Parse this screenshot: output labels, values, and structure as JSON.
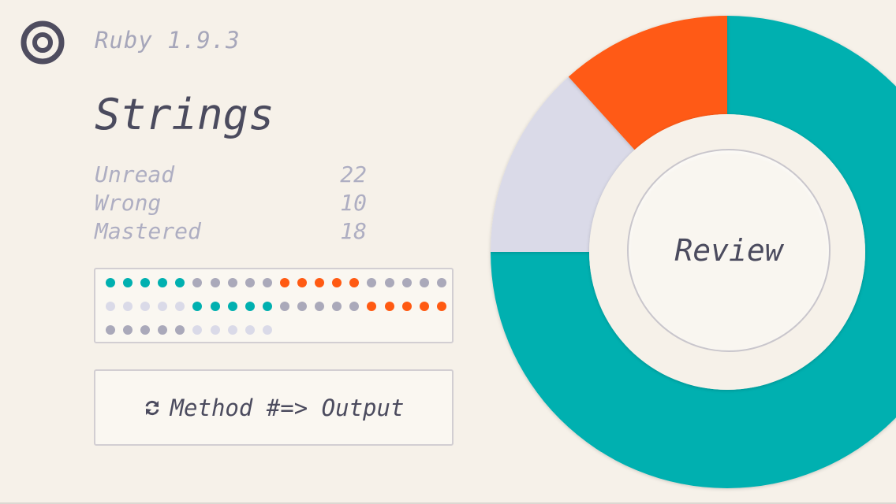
{
  "header": {
    "logo_icon": "target-rings-icon",
    "version": "Ruby 1.9.3"
  },
  "title": "Strings",
  "stats": [
    {
      "label": "Unread",
      "value": "22"
    },
    {
      "label": "Wrong",
      "value": "10"
    },
    {
      "label": "Mastered",
      "value": "18"
    }
  ],
  "colors": {
    "background": "#f6f1e9",
    "mastered": "#00b0b0",
    "wrong": "#ff5a12",
    "unread": "#dadae8",
    "seen": "#aaa9ba",
    "text_dark": "#4b4b5e",
    "text_muted": "#aeaec2"
  },
  "progress_dots": [
    "mastered",
    "mastered",
    "mastered",
    "mastered",
    "mastered",
    "seen",
    "seen",
    "seen",
    "seen",
    "seen",
    "wrong",
    "wrong",
    "wrong",
    "wrong",
    "wrong",
    "seen",
    "seen",
    "seen",
    "seen",
    "seen",
    "unread",
    "unread",
    "unread",
    "unread",
    "unread",
    "mastered",
    "mastered",
    "mastered",
    "mastered",
    "mastered",
    "seen",
    "seen",
    "seen",
    "seen",
    "seen",
    "wrong",
    "wrong",
    "wrong",
    "wrong",
    "wrong",
    "seen",
    "seen",
    "seen",
    "seen",
    "seen",
    "unread",
    "unread",
    "unread",
    "unread",
    "unread"
  ],
  "method_button": {
    "icon": "refresh-icon",
    "label": "Method #=> Output"
  },
  "chart_data": {
    "type": "pie",
    "variant": "donut",
    "start": "top",
    "direction": "clockwise",
    "slices": [
      {
        "name": "Mastered",
        "fraction": 0.75,
        "color": "#00b0b0"
      },
      {
        "name": "Unread",
        "fraction": 0.133,
        "color": "#dadae8"
      },
      {
        "name": "Wrong",
        "fraction": 0.117,
        "color": "#ff5a12"
      }
    ],
    "center_label": "Review"
  }
}
